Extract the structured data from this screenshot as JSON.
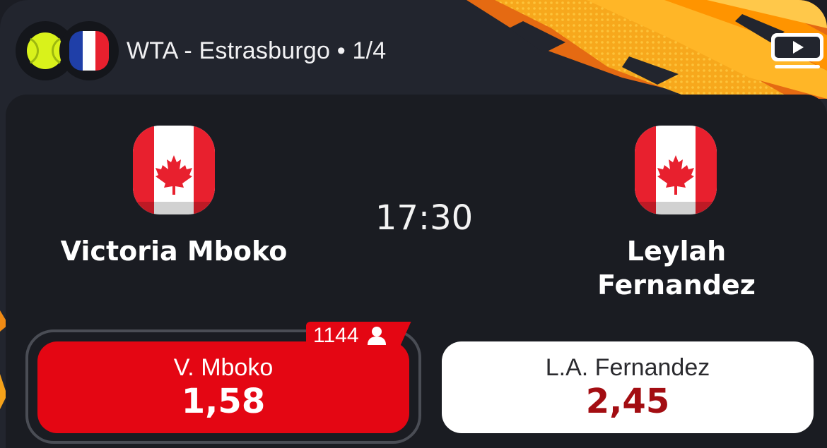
{
  "header": {
    "title": "WTA - Estrasburgo • 1/4",
    "sport_icon": "tennis-ball-icon",
    "country_flag": "flag-france-icon",
    "stream_icon": "tv-play-icon"
  },
  "match": {
    "time": "17:30",
    "home": {
      "name": "Victoria Mboko",
      "flag": "flag-canada-icon"
    },
    "away": {
      "name_line1": "Leylah",
      "name_line2": "Fernandez",
      "flag": "flag-canada-icon"
    }
  },
  "odds": {
    "home": {
      "label": "V. Mboko",
      "value": "1,58",
      "selected": true
    },
    "away": {
      "label": "L.A. Fernandez",
      "value": "2,45",
      "selected": false
    },
    "bettors_count": "1144",
    "bettors_icon": "user-icon"
  },
  "colors": {
    "accent_red": "#e40613",
    "odd_value_dark_red": "#a30d12",
    "background": "#1a1c22",
    "header_bg": "#22252e",
    "art_orange": "#f59a12"
  }
}
